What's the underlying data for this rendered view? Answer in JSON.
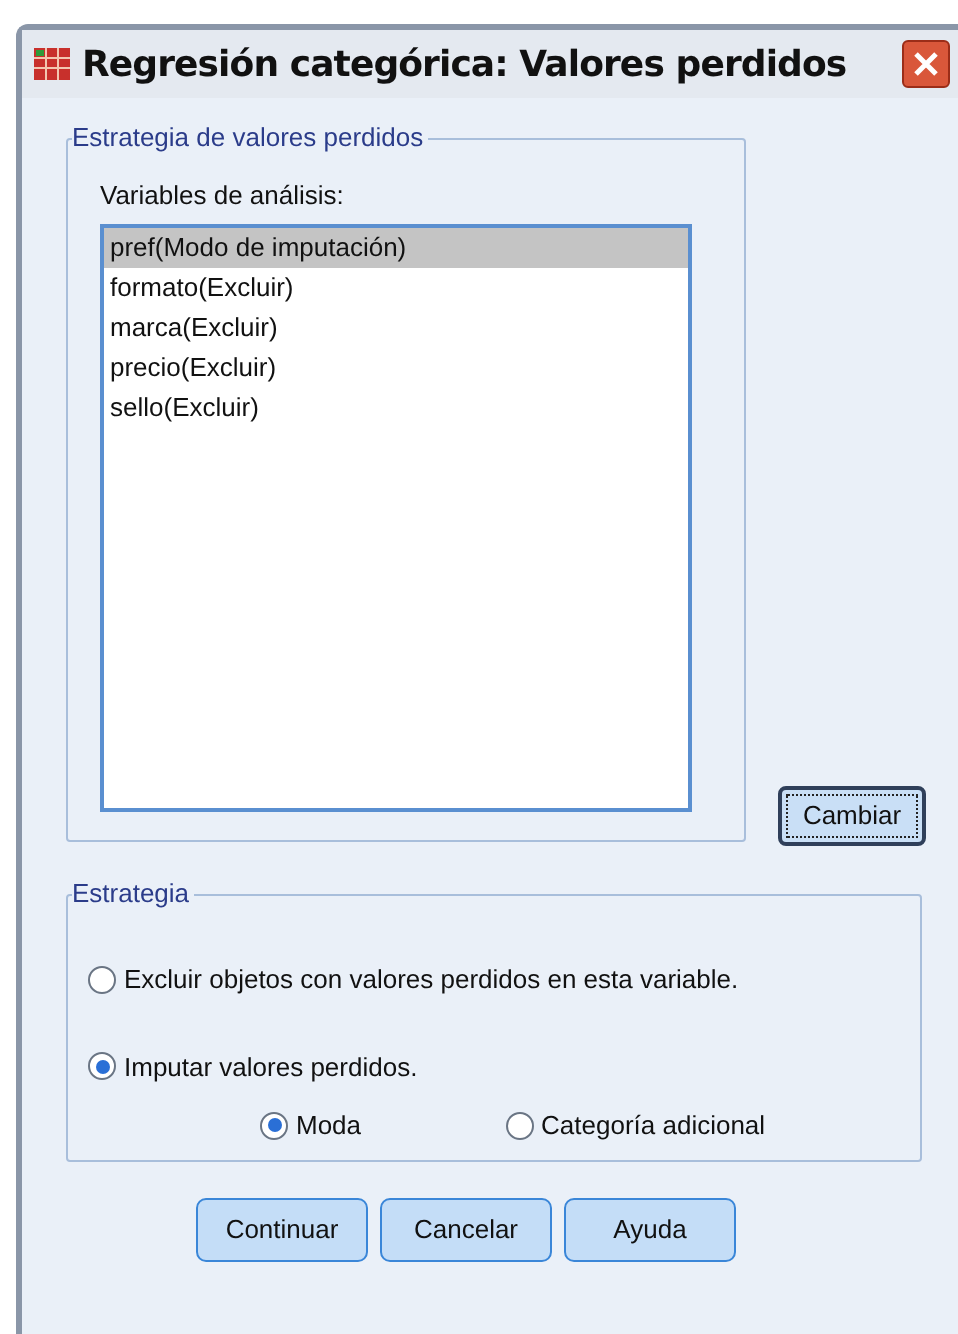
{
  "window": {
    "title": "Regresión categórica: Valores perdidos"
  },
  "missing_group": {
    "title": "Estrategia de valores perdidos",
    "list_label": "Variables de análisis:",
    "variables": [
      {
        "label": "pref(Modo de imputación)",
        "selected": true
      },
      {
        "label": "formato(Excluir)",
        "selected": false
      },
      {
        "label": "marca(Excluir)",
        "selected": false
      },
      {
        "label": "precio(Excluir)",
        "selected": false
      },
      {
        "label": "sello(Excluir)",
        "selected": false
      }
    ],
    "change_button": "Cambiar"
  },
  "strategy_group": {
    "title": "Estrategia",
    "options": [
      {
        "label": "Excluir objetos con valores perdidos en esta variable.",
        "selected": false
      },
      {
        "label": "Imputar valores perdidos.",
        "selected": true
      }
    ],
    "impute_options": [
      {
        "label": "Moda",
        "selected": true
      },
      {
        "label": "Categoría adicional",
        "selected": false
      }
    ]
  },
  "buttons": [
    "Continuar",
    "Cancelar",
    "Ayuda"
  ]
}
